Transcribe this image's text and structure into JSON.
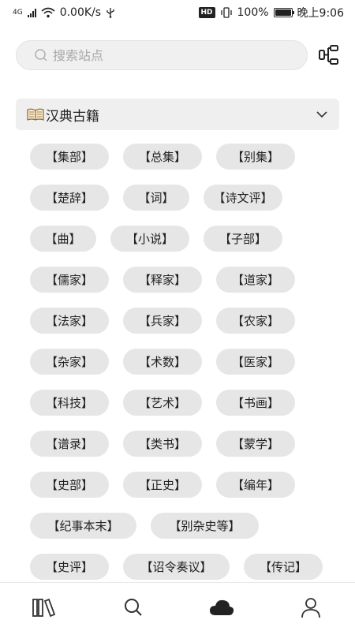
{
  "status_bar": {
    "network": "4G",
    "speed": "0.00K/s",
    "hd": "HD",
    "battery": "100%",
    "time": "晚上9:06"
  },
  "search": {
    "placeholder": "搜索站点"
  },
  "section": {
    "title": "汉典古籍"
  },
  "tags": [
    [
      "【集部】",
      "【总集】",
      "【别集】"
    ],
    [
      "【楚辞】",
      "【词】",
      "【诗文评】"
    ],
    [
      "【曲】",
      "【小说】",
      "【子部】"
    ],
    [
      "【儒家】",
      "【释家】",
      "【道家】"
    ],
    [
      "【法家】",
      "【兵家】",
      "【农家】"
    ],
    [
      "【杂家】",
      "【术数】",
      "【医家】"
    ],
    [
      "【科技】",
      "【艺术】",
      "【书画】"
    ],
    [
      "【谱录】",
      "【类书】",
      "【蒙学】"
    ],
    [
      "【史部】",
      "【正史】",
      "【编年】"
    ],
    [
      "【纪事本末】",
      "【别杂史等】"
    ],
    [
      "【史评】",
      "【诏令奏议】",
      "【传记】"
    ]
  ],
  "tab_bar": {
    "icons": [
      "bookshelf-icon",
      "search-icon",
      "cloud-icon",
      "profile-icon"
    ]
  },
  "colors": {
    "chip_bg": "#e6e6e6",
    "section_bg": "#efefef",
    "search_bg": "#f0f0f0"
  }
}
